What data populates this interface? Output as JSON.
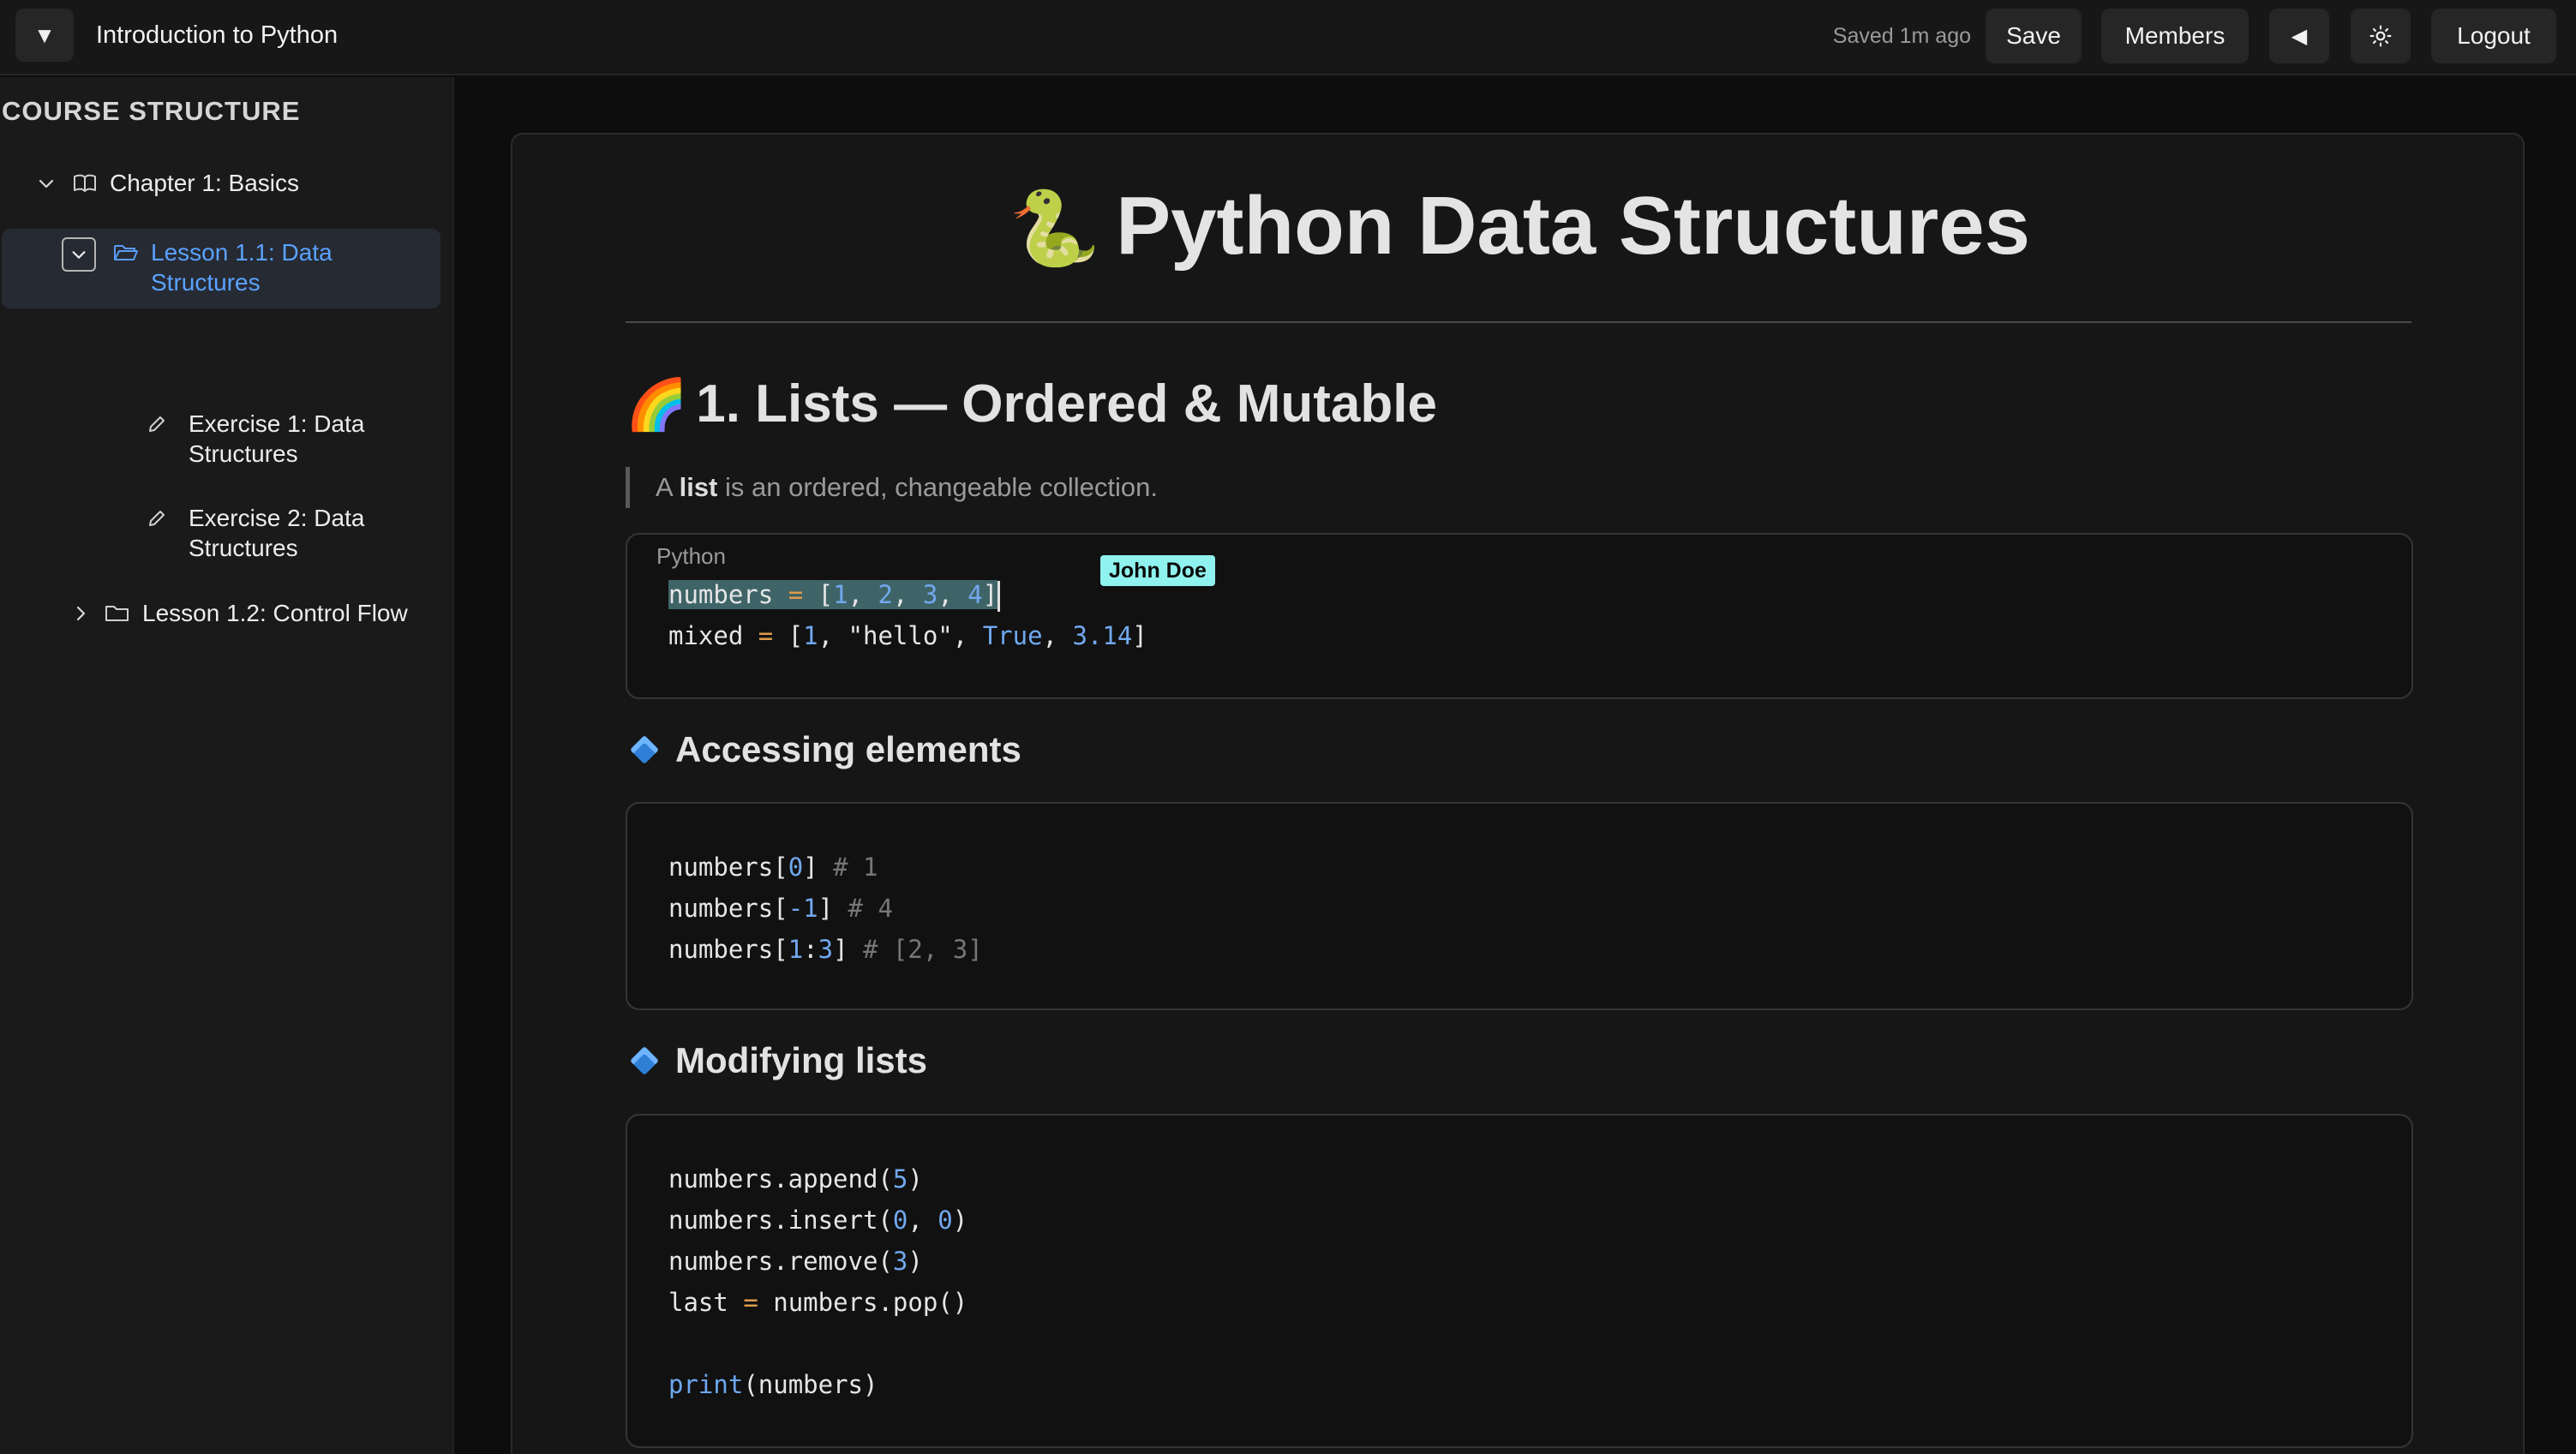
{
  "topbar": {
    "menu_icon": "▼",
    "title": "Introduction to Python",
    "saved_status": "Saved 1m ago",
    "save_label": "Save",
    "members_label": "Members",
    "collapse_icon": "◀",
    "logout_label": "Logout"
  },
  "sidebar": {
    "heading": "COURSE STRUCTURE",
    "chapter": "Chapter 1: Basics",
    "lesson_active": "Lesson 1.1: Data Structures",
    "exercise_1": "Exercise 1: Data Structures",
    "exercise_2": "Exercise 2: Data Structures",
    "lesson_2": "Lesson 1.2: Control Flow"
  },
  "content": {
    "title_emoji": "🐍",
    "title": "Python Data Structures",
    "section_emoji": "🌈",
    "section_title": "1. Lists — Ordered & Mutable",
    "quote_prefix": "A ",
    "quote_bold": "list",
    "quote_suffix": " is an ordered, changeable collection.",
    "code1_lang": "Python",
    "collaborator": "John Doe",
    "h3_access": "Accessing elements",
    "h3_modify": "Modifying lists"
  },
  "colors": {
    "accent": "#5aa2ff",
    "collab_tag": "#8ff2ee",
    "selection": "#3f6468"
  }
}
